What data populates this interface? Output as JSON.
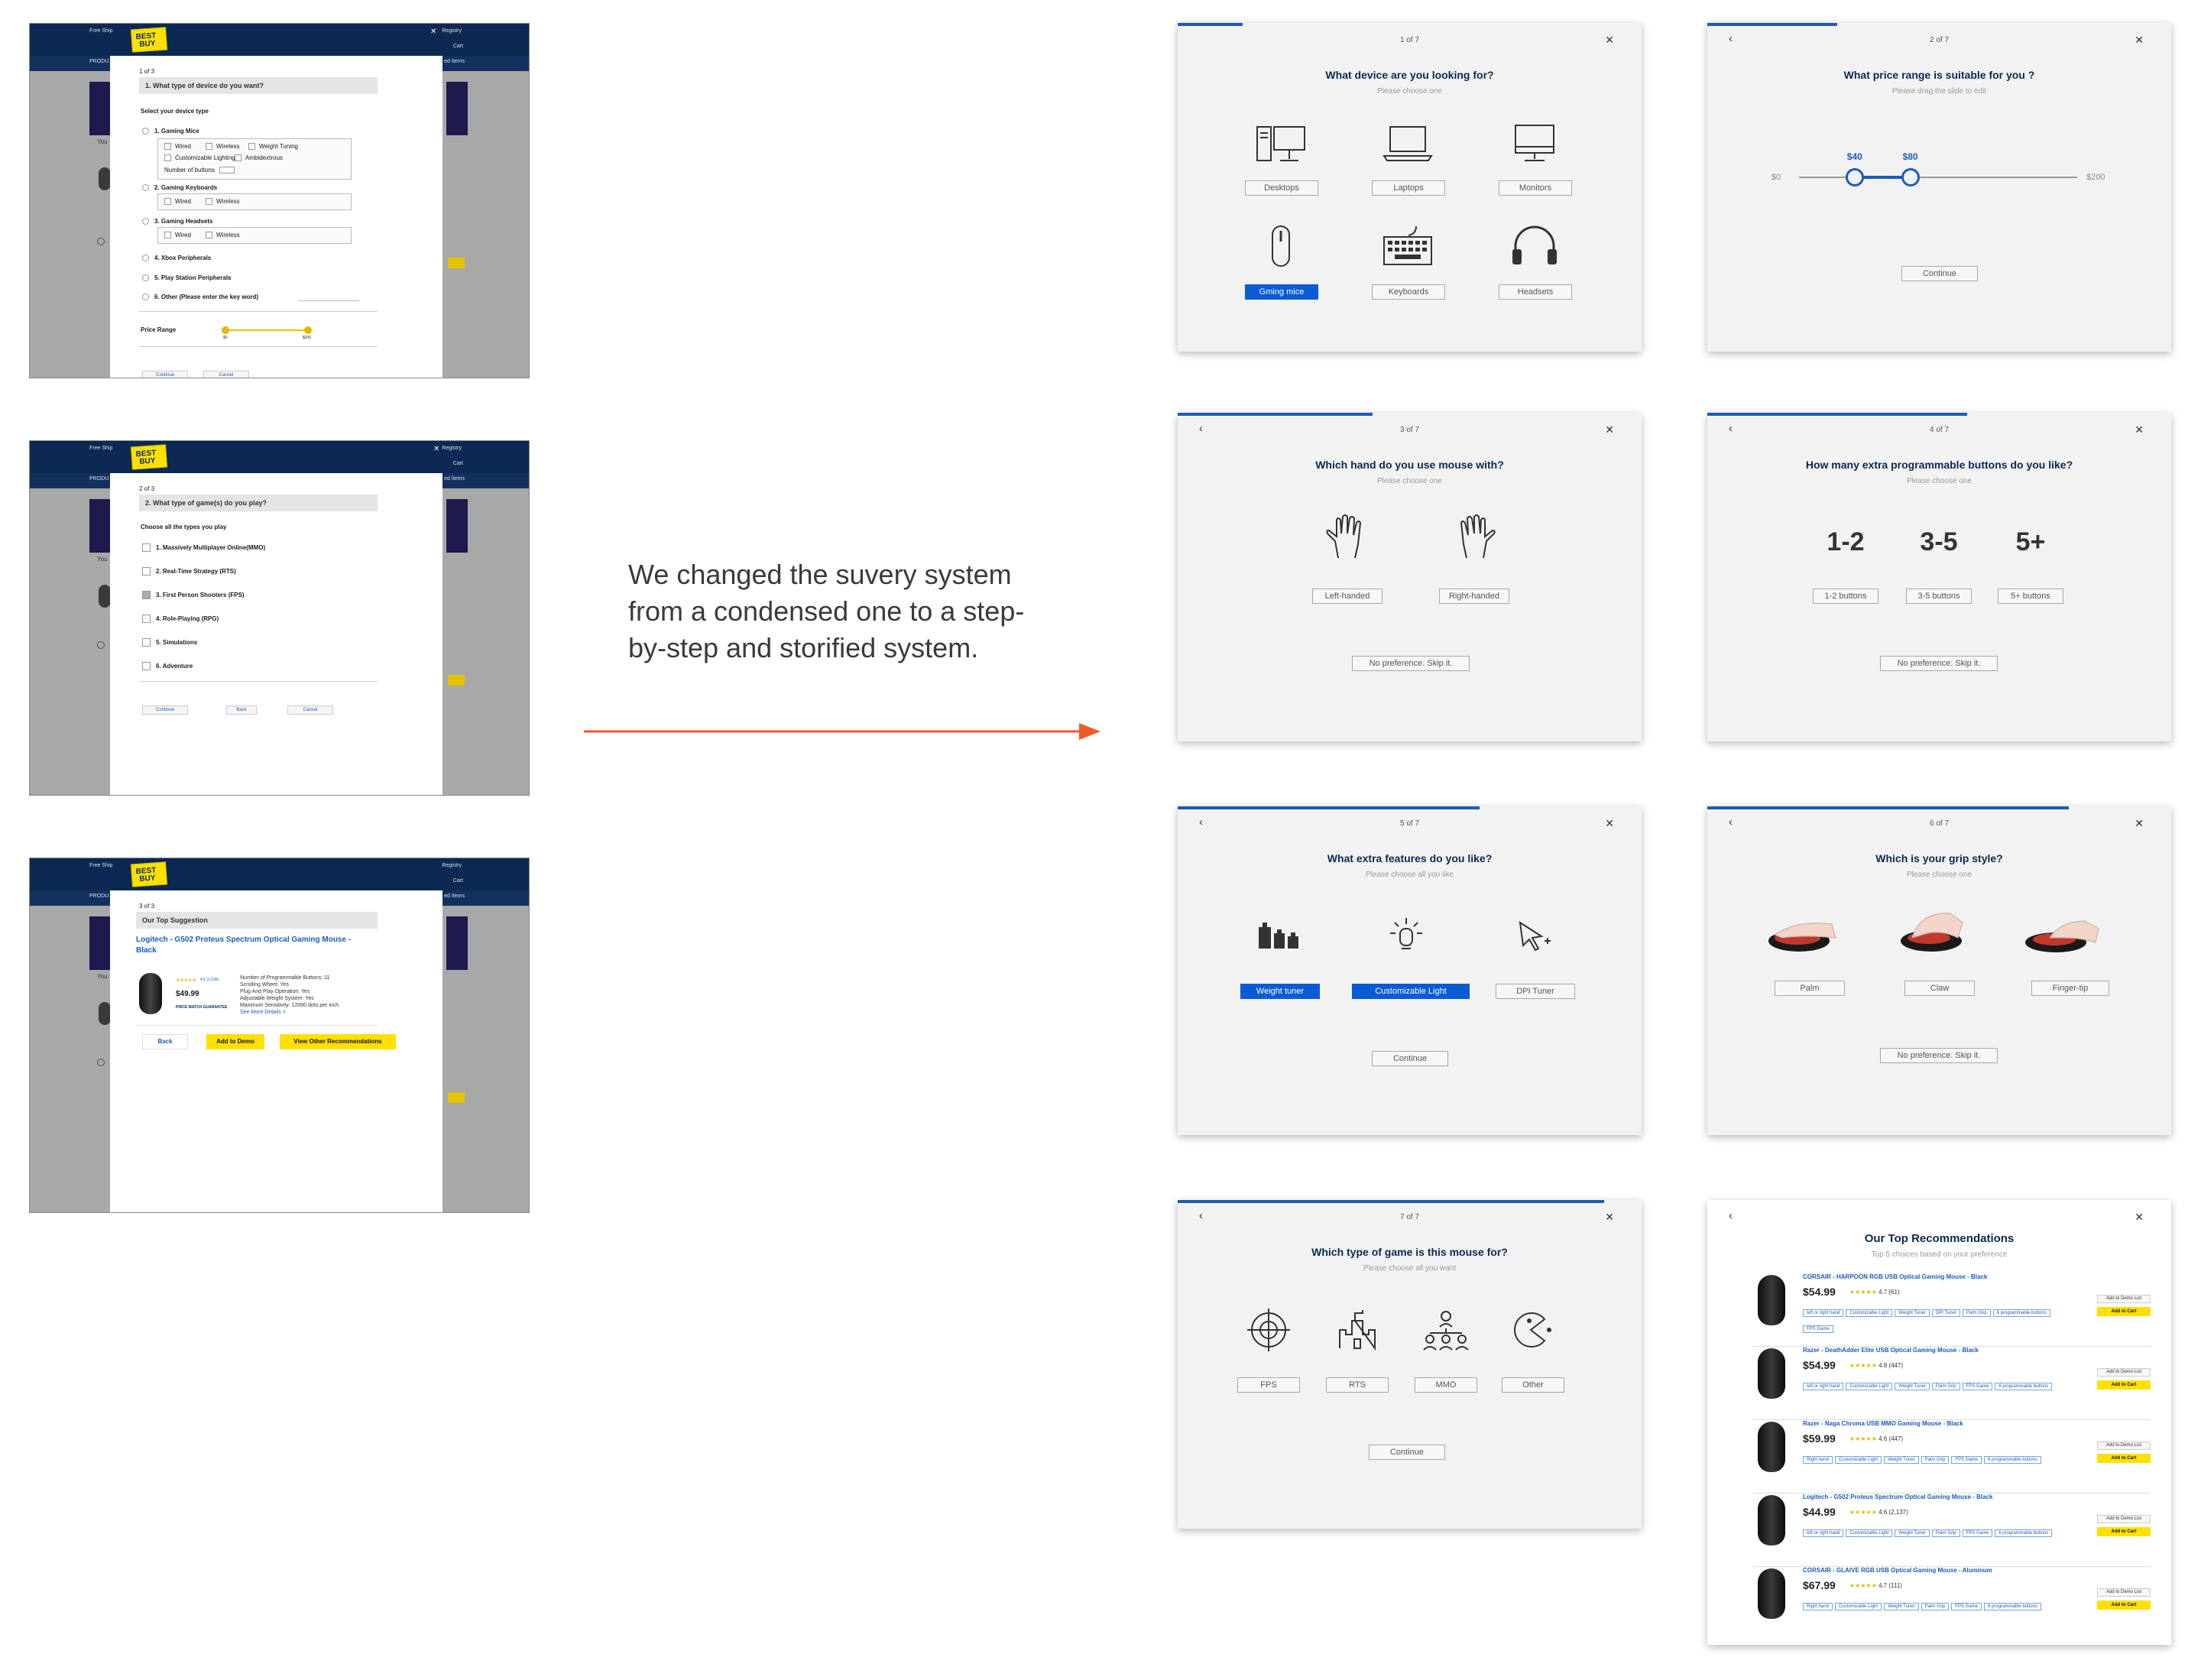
{
  "caption": {
    "line1": "We changed the suvery system",
    "line2": "from a condensed one to a step-",
    "line3": "by-step and storified system."
  },
  "colors": {
    "accent": "#1d5bb8",
    "arrow": "#f05a28",
    "brand_yellow": "#ffe000",
    "brand_navy": "#0b2952"
  },
  "old_survey": {
    "brand": {
      "top": "BEST",
      "bottom": "BUY"
    },
    "header": {
      "free_ship": "Free Ship",
      "registry": "Registry",
      "cart": "Cart",
      "products": "PRODU",
      "saved": "ed Items",
      "you": "You"
    },
    "shot1": {
      "step": "1 of 3",
      "question": "1. What type of device do you want?",
      "instruction": "Select your device type",
      "gaming_mice": "1. Gaming Mice",
      "opts_mice": [
        "Wired",
        "Wireless",
        "Weight Tuning",
        "Customizable Lighting",
        "Ambidextrous"
      ],
      "num_buttons": "Number of buttons",
      "gaming_keyboards": "2. Gaming Keyboards",
      "opts_kb": [
        "Wired",
        "Wireless"
      ],
      "gaming_headsets": "3. Gaming Headsets",
      "opts_hs": [
        "Wired",
        "Wireless"
      ],
      "xbox": "4. Xbox Peripherals",
      "playstation": "5. Play Station Peripherals",
      "other": "6. Other (Please enter the key word)",
      "price_range": "Price Range",
      "price_min": "$0",
      "price_max": "$200",
      "continue": "Continue",
      "cancel": "Cancel"
    },
    "shot2": {
      "step": "2 of 3",
      "question": "2. What type of game(s) do you play?",
      "instruction": "Choose all the types you play",
      "games": [
        "1. Massively Multiplayer Online(MMO)",
        "2. Real-Time Strategy (RTS)",
        "3. First Person Shooters (FPS)",
        "4. Role-Playing (RPG)",
        "5. Simulations",
        "6. Adventure"
      ],
      "continue": "Continue",
      "back": "Back",
      "cancel": "Cancel"
    },
    "shot3": {
      "step": "3 of 3",
      "heading": "Our Top Suggestion",
      "product": "Logitech - G502 Proteus Spectrum Optical Gaming Mouse - Black",
      "price": "$49.99",
      "rating": "4.6 (2,036)",
      "price_match": "PRICE MATCH GUARANTEE",
      "specs": [
        "Number of Programmable Buttons: 11",
        "Scrolling Wheel: Yes",
        "Plug And Play Operation: Yes",
        "Adjustable Weight System: Yes",
        "Maximum Sensitivity: 12000 dots per inch"
      ],
      "more": "See More Details >",
      "back": "Back",
      "add_demo": "Add to Demo",
      "view_other": "View Other Recommendations"
    }
  },
  "new_survey": {
    "s1": {
      "step": "1 of 7",
      "progress": 0.14,
      "question": "What device are you looking for?",
      "sub": "Please choose one",
      "options": [
        "Desktops",
        "Laptops",
        "Monitors",
        "Gming mice",
        "Keyboards",
        "Headsets"
      ],
      "selected": "Gming mice"
    },
    "s2": {
      "step": "2 of 7",
      "progress": 0.28,
      "question": "What price range is suitable for you ?",
      "sub": "Please drag the slide to edit",
      "min": "$0",
      "max": "$200",
      "low": "$40",
      "high": "$80",
      "low_val": 40,
      "high_val": 80,
      "range_max": 200,
      "continue": "Continue"
    },
    "s3": {
      "step": "3 of 7",
      "progress": 0.42,
      "question": "Which hand do you use mouse with?",
      "sub": "Please choose one",
      "options": [
        "Left-handed",
        "Right-handed"
      ],
      "skip": "No preference. Skip it."
    },
    "s4": {
      "step": "4 of 7",
      "progress": 0.56,
      "question": "How many extra programmable buttons do you like?",
      "sub": "Please choose one",
      "big": [
        "1-2",
        "3-5",
        "5+"
      ],
      "options": [
        "1-2 buttons",
        "3-5 buttons",
        "5+ buttons"
      ],
      "skip": "No preference. Skip it."
    },
    "s5": {
      "step": "5 of 7",
      "progress": 0.65,
      "question": "What extra features do you like?",
      "sub": "Please choose all you like",
      "options": [
        "Weight tuner",
        "Customizable Light",
        "DPI Tuner"
      ],
      "selected": [
        "Weight tuner",
        "Customizable Light"
      ],
      "continue": "Continue"
    },
    "s6": {
      "step": "6 of 7",
      "progress": 0.78,
      "question": "Which is your grip style?",
      "sub": "Please choose one",
      "options": [
        "Palm",
        "Claw",
        "Finger-tip"
      ],
      "skip": "No preference. Skip it."
    },
    "s7": {
      "step": "7 of 7",
      "progress": 0.92,
      "question": "Which type of game is this mouse for?",
      "sub": "Please choose all you want",
      "options": [
        "FPS",
        "RTS",
        "MMO",
        "Other"
      ],
      "continue": "Continue"
    },
    "recs": {
      "title": "Our Top Recommendations",
      "sub": "Top 5 choices based on your preference",
      "wishlist": "Add to Demo List",
      "cart": "Add to Cart",
      "items": [
        {
          "name": "CORSAIR - HARPOON RGB USB Optical Gaming Mouse - Black",
          "price": "$54.99",
          "rating": "4.7 (61)",
          "tags": [
            "left or right hand",
            "Customizable Light",
            "Weight Tuner",
            "DPI Tuner",
            "Palm Grip",
            "6 programmable buttons",
            "FPS Game"
          ]
        },
        {
          "name": "Razer - DeathAdder Elite USB Optical Gaming Mouse - Black",
          "price": "$54.99",
          "rating": "4.8 (447)",
          "tags": [
            "left or right hand",
            "Customizable Light",
            "Weight Tuner",
            "Palm Grip",
            "FPS Game",
            "6 programmable buttons"
          ]
        },
        {
          "name": "Razer - Naga Chroma USB MMO Gaming Mouse - Black",
          "price": "$59.99",
          "rating": "4.6 (447)",
          "tags": [
            "Right hand",
            "Customizable Light",
            "Weight Tuner",
            "Palm Grip",
            "FPS Game",
            "6 programmable buttons"
          ]
        },
        {
          "name": "Logitech - G502 Proteus Spectrum Optical Gaming Mouse - Black",
          "price": "$44.99",
          "rating": "4.6 (2,137)",
          "tags": [
            "left or right hand",
            "Customizable Light",
            "Weight Tuner",
            "Palm Grip",
            "FPS Game",
            "6 programmable buttons"
          ]
        },
        {
          "name": "CORSAIR - GLAIVE RGB USB Optical Gaming Mouse - Aluminum",
          "price": "$67.99",
          "rating": "4.7 (111)",
          "tags": [
            "Right hand",
            "Customizable Light",
            "Weight Tuner",
            "Palm Grip",
            "FPS Game",
            "6 programmable buttons"
          ]
        }
      ]
    }
  }
}
